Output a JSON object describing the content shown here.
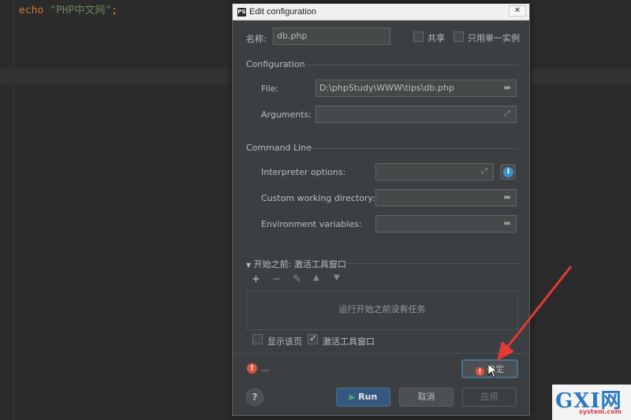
{
  "editor": {
    "code_keyword": "echo",
    "code_string": "\"PHP中文网\"",
    "code_semicolon": ";"
  },
  "dialog": {
    "title": "Edit configuration",
    "close_icon": "close-icon",
    "name_label": "名称:",
    "name_value": "db.php",
    "share_label": "共享",
    "single_instance_label": "只用单一实例",
    "configuration_section": "Configuration",
    "file_label": "File:",
    "file_value": "D:\\phpStudy\\WWW\\tips\\db.php",
    "arguments_label": "Arguments:",
    "arguments_value": "",
    "command_line_section": "Command Line",
    "interpreter_label": "Interpreter options:",
    "interpreter_value": "",
    "working_dir_label": "Custom working directory:",
    "working_dir_value": "",
    "env_label": "Environment variables:",
    "env_value": "",
    "before_launch_section": "开始之前: 激活工具窗口",
    "no_tasks_text": "运行开始之前没有任务",
    "show_page_label": "显示该页",
    "show_page_checked": false,
    "activate_tool_label": "激活工具窗口",
    "activate_tool_checked": true,
    "warning_text": "...",
    "run_button": "Run",
    "cancel_button": "取消",
    "apply_button": "应用",
    "ok_button": "确定"
  },
  "icons": {
    "folder": "folder-icon",
    "expand": "expand-icon",
    "info": "info-icon",
    "warning": "warning-icon",
    "help": "help-icon",
    "add": "add-icon",
    "remove": "remove-icon",
    "edit": "edit-icon",
    "up": "move-up-icon",
    "down": "move-down-icon"
  },
  "colors": {
    "accent": "#365880",
    "warning": "#e0533d",
    "annotation_arrow": "#e53935"
  },
  "watermark": {
    "logo": "GXI网",
    "site": "system.com"
  }
}
